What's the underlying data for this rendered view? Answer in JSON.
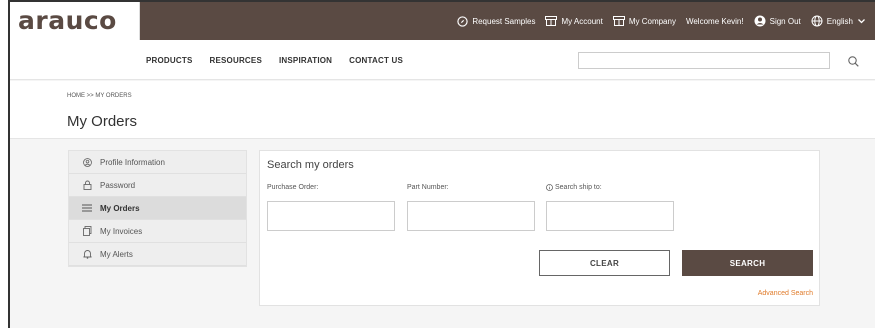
{
  "brand": {
    "logo_text": "arauco"
  },
  "topnav": {
    "request_samples": "Request Samples",
    "my_account": "My Account",
    "my_company": "My Company",
    "welcome": "Welcome Kevin!",
    "sign_out": "Sign Out",
    "language": "English"
  },
  "menu": {
    "items": [
      "PRODUCTS",
      "RESOURCES",
      "INSPIRATION",
      "CONTACT US"
    ],
    "search_placeholder": ""
  },
  "header": {
    "breadcrumb": "HOME >> MY ORDERS",
    "title": "My Orders"
  },
  "sidebar": {
    "items": [
      {
        "label": "Profile Information",
        "icon": "user-circle-icon"
      },
      {
        "label": "Password",
        "icon": "lock-icon"
      },
      {
        "label": "My Orders",
        "icon": "list-icon",
        "active": true
      },
      {
        "label": "My Invoices",
        "icon": "invoice-icon"
      },
      {
        "label": "My Alerts",
        "icon": "bell-icon"
      }
    ]
  },
  "search_panel": {
    "title": "Search my orders",
    "purchase_order_label": "Purchase Order:",
    "part_number_label": "Part Number:",
    "ship_to_label": "Search ship to:",
    "purchase_order_value": "",
    "part_number_value": "",
    "ship_to_value": "",
    "clear_label": "CLEAR",
    "search_label": "SEARCH",
    "advanced_search": "Advanced Search"
  },
  "colors": {
    "brand_brown": "#5a4a43",
    "link_orange": "#e07b2a"
  }
}
